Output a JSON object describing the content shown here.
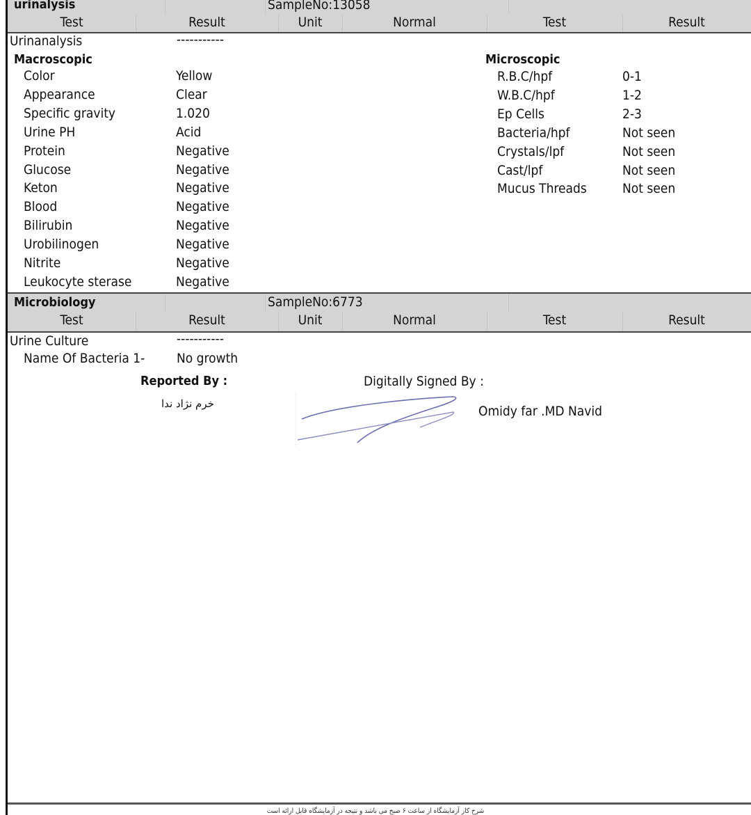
{
  "sections": [
    {
      "title": "urinalysis",
      "sample": "SampleNo:13058"
    },
    {
      "title": "Microbiology",
      "sample": "SampleNo:6773"
    }
  ],
  "columns": [
    "Test",
    "Result",
    "Unit",
    "Normal",
    "Test",
    "Result"
  ],
  "urinalysis": {
    "group": "Urinanalysis",
    "group_result": "-----------",
    "macro_title": "Macroscopic",
    "macro": [
      {
        "test": "Color",
        "result": "Yellow"
      },
      {
        "test": "Appearance",
        "result": "Clear"
      },
      {
        "test": "Specific gravity",
        "result": "1.020"
      },
      {
        "test": "Urine PH",
        "result": "Acid"
      },
      {
        "test": "Protein",
        "result": "Negative"
      },
      {
        "test": "Glucose",
        "result": "Negative"
      },
      {
        "test": "Keton",
        "result": "Negative"
      },
      {
        "test": "Blood",
        "result": "Negative"
      },
      {
        "test": "Bilirubin",
        "result": "Negative"
      },
      {
        "test": "Urobilinogen",
        "result": "Negative"
      },
      {
        "test": "Nitrite",
        "result": "Negative"
      },
      {
        "test": "Leukocyte sterase",
        "result": "Negative"
      }
    ],
    "micro_title": "Microscopic",
    "micro": [
      {
        "test": "R.B.C/hpf",
        "result": "0-1"
      },
      {
        "test": "W.B.C/hpf",
        "result": "1-2"
      },
      {
        "test": "Ep Cells",
        "result": "2-3"
      },
      {
        "test": "Bacteria/hpf",
        "result": "Not seen"
      },
      {
        "test": "Crystals/lpf",
        "result": "Not seen"
      },
      {
        "test": "Cast/lpf",
        "result": "Not seen"
      },
      {
        "test": "Mucus Threads",
        "result": "Not seen"
      }
    ]
  },
  "microbiology": {
    "group": "Urine Culture",
    "group_result": "-----------",
    "rows": [
      {
        "test": "Name Of Bacteria 1-",
        "result": "No growth"
      }
    ]
  },
  "signature": {
    "reported_by_label": "Reported By :",
    "reported_by_name": "خرم نژاد ندا",
    "signed_by_label": "Digitally Signed By :",
    "signed_by_name": "Omidy far .MD Navid",
    "ink_color": "#6a6fb0"
  },
  "footer": {
    "text": "شرح کار آزمایشگاه از ساعت ۶ صبح می باشد و نتیجه در آزمایشگاه قابل ارائه است"
  }
}
